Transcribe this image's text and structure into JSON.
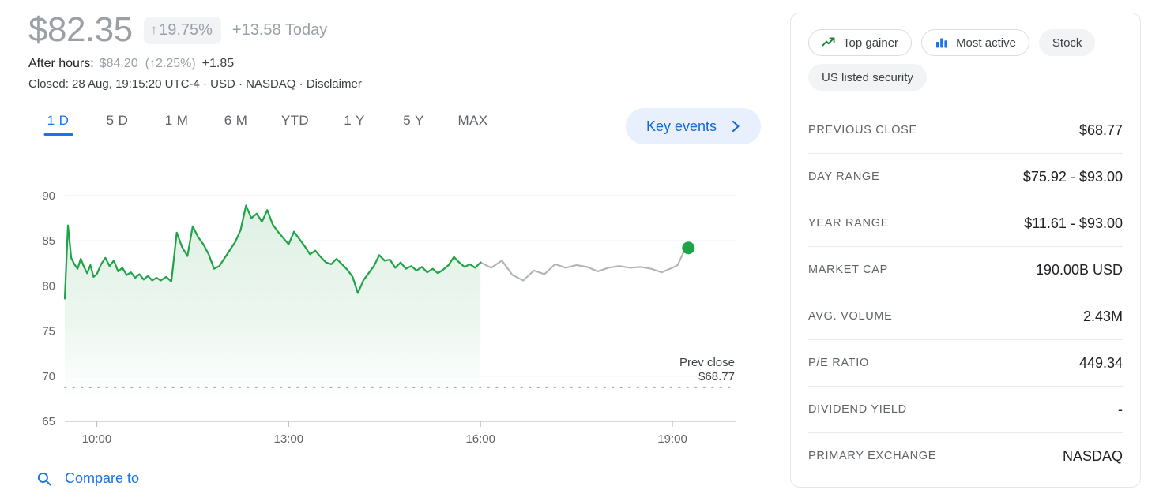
{
  "quote": {
    "price": "$82.35",
    "change_arrow": "↑",
    "change_percent": "19.75%",
    "change_absolute": "+13.58 Today",
    "after_hours_label": "After hours:",
    "after_hours_price": "$84.20",
    "after_hours_percent": "(↑2.25%)",
    "after_hours_change": "+1.85",
    "closed_text": "Closed: 28 Aug, 19:15:20 UTC-4 · USD · NASDAQ · ",
    "disclaimer_link": "Disclaimer"
  },
  "range_tabs": [
    {
      "label": "1 D",
      "active": true
    },
    {
      "label": "5 D",
      "active": false
    },
    {
      "label": "1 M",
      "active": false
    },
    {
      "label": "6 M",
      "active": false
    },
    {
      "label": "YTD",
      "active": false
    },
    {
      "label": "1 Y",
      "active": false
    },
    {
      "label": "5 Y",
      "active": false
    },
    {
      "label": "MAX",
      "active": false
    }
  ],
  "key_events_button": "Key events",
  "compare_to": "Compare to",
  "chart_data": {
    "type": "line",
    "title": "",
    "xlabel": "",
    "ylabel": "",
    "ylim": [
      65,
      92
    ],
    "yticks": [
      90,
      85,
      80,
      75,
      70,
      65
    ],
    "xticks": [
      "10:00",
      "13:00",
      "16:00",
      "19:00"
    ],
    "grid": true,
    "legend_position": "none",
    "prev_close_label": "Prev close",
    "prev_close_value": "$68.77",
    "prev_close_level": 68.77,
    "accent_color": "#1ea446",
    "after_hours_color": "#b0b3b8",
    "fill_color": "#e6f4ea",
    "series": [
      {
        "name": "Regular hours",
        "color": "#1ea446",
        "filled": true,
        "x": [
          "09:30",
          "09:33",
          "09:36",
          "09:39",
          "09:42",
          "09:45",
          "09:48",
          "09:51",
          "09:54",
          "09:57",
          "10:00",
          "10:04",
          "10:08",
          "10:12",
          "10:16",
          "10:20",
          "10:24",
          "10:28",
          "10:32",
          "10:36",
          "10:40",
          "10:44",
          "10:48",
          "10:52",
          "10:56",
          "11:00",
          "11:05",
          "11:10",
          "11:15",
          "11:20",
          "11:25",
          "11:30",
          "11:35",
          "11:40",
          "11:45",
          "11:50",
          "11:55",
          "12:00",
          "12:05",
          "12:10",
          "12:15",
          "12:20",
          "12:25",
          "12:30",
          "12:35",
          "12:40",
          "12:45",
          "12:50",
          "12:55",
          "13:00",
          "13:05",
          "13:10",
          "13:15",
          "13:20",
          "13:25",
          "13:30",
          "13:35",
          "13:40",
          "13:45",
          "13:50",
          "13:55",
          "14:00",
          "14:05",
          "14:10",
          "14:15",
          "14:20",
          "14:25",
          "14:30",
          "14:35",
          "14:40",
          "14:45",
          "14:50",
          "14:55",
          "15:00",
          "15:05",
          "15:10",
          "15:15",
          "15:20",
          "15:25",
          "15:30",
          "15:35",
          "15:40",
          "15:45",
          "15:50",
          "15:55",
          "16:00"
        ],
        "values": [
          78.6,
          86.7,
          83.1,
          82.4,
          81.9,
          83.0,
          82.1,
          81.4,
          82.3,
          81.0,
          81.3,
          82.4,
          83.1,
          82.2,
          82.8,
          81.6,
          82.0,
          81.2,
          81.5,
          80.9,
          81.3,
          80.7,
          81.1,
          80.6,
          80.9,
          80.6,
          81.0,
          80.5,
          85.9,
          84.3,
          83.3,
          86.6,
          85.4,
          84.6,
          83.5,
          81.9,
          82.2,
          83.1,
          84.0,
          84.9,
          86.2,
          88.9,
          87.5,
          88.0,
          87.1,
          88.4,
          86.8,
          86.0,
          85.3,
          84.6,
          86.0,
          85.2,
          84.4,
          83.5,
          83.9,
          83.2,
          82.6,
          82.4,
          83.0,
          82.4,
          81.8,
          81.0,
          79.2,
          80.6,
          81.4,
          82.2,
          83.4,
          82.8,
          82.9,
          82.0,
          82.6,
          81.9,
          82.2,
          81.7,
          82.1,
          81.5,
          81.9,
          81.4,
          81.8,
          82.3,
          83.2,
          82.6,
          82.1,
          82.4,
          82.0,
          82.6
        ]
      },
      {
        "name": "After hours",
        "color": "#b0b3b8",
        "filled": false,
        "x": [
          "16:00",
          "16:10",
          "16:20",
          "16:30",
          "16:40",
          "16:50",
          "17:00",
          "17:10",
          "17:20",
          "17:30",
          "17:40",
          "17:50",
          "18:00",
          "18:10",
          "18:20",
          "18:30",
          "18:40",
          "18:50",
          "19:00",
          "19:05",
          "19:10",
          "19:15"
        ],
        "values": [
          82.6,
          82.0,
          82.8,
          81.2,
          80.6,
          81.7,
          81.3,
          82.4,
          82.0,
          82.3,
          82.1,
          81.6,
          82.0,
          82.2,
          82.0,
          82.1,
          81.9,
          81.5,
          82.0,
          82.3,
          83.6,
          84.2
        ]
      }
    ],
    "end_marker": {
      "value": 84.2,
      "color": "#1ea446"
    }
  },
  "info_card": {
    "chips": [
      {
        "label": "Top gainer",
        "icon": "trending-up-icon",
        "style": "outline"
      },
      {
        "label": "Most active",
        "icon": "bar-chart-icon",
        "style": "outline"
      },
      {
        "label": "Stock",
        "icon": "",
        "style": "filled"
      },
      {
        "label": "US listed security",
        "icon": "",
        "style": "filled"
      }
    ],
    "stats": [
      {
        "label": "PREVIOUS CLOSE",
        "value": "$68.77"
      },
      {
        "label": "DAY RANGE",
        "value": "$75.92 - $93.00"
      },
      {
        "label": "YEAR RANGE",
        "value": "$11.61 - $93.00"
      },
      {
        "label": "MARKET CAP",
        "value": "190.00B USD"
      },
      {
        "label": "AVG. VOLUME",
        "value": "2.43M"
      },
      {
        "label": "P/E RATIO",
        "value": "449.34"
      },
      {
        "label": "DIVIDEND YIELD",
        "value": "-"
      },
      {
        "label": "PRIMARY EXCHANGE",
        "value": "NASDAQ"
      }
    ]
  }
}
